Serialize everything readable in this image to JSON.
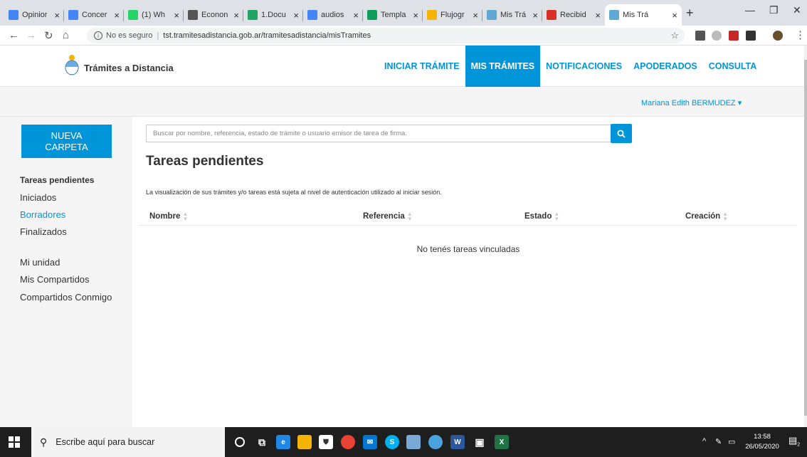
{
  "browser": {
    "tabs": [
      {
        "title": "Opinior",
        "icon": "docs-icon",
        "color": "#4285f4"
      },
      {
        "title": "Concer",
        "icon": "docs-icon",
        "color": "#4285f4"
      },
      {
        "title": "(1) Wh",
        "icon": "whatsapp-icon",
        "color": "#25d366"
      },
      {
        "title": "Econon",
        "icon": "site-icon",
        "color": "#555555"
      },
      {
        "title": "1.Docu",
        "icon": "drive-icon",
        "color": "#1fa463"
      },
      {
        "title": "audios",
        "icon": "docs-icon",
        "color": "#4285f4"
      },
      {
        "title": "Templa",
        "icon": "sheets-icon",
        "color": "#0f9d58"
      },
      {
        "title": "Flujogr",
        "icon": "slides-icon",
        "color": "#f4b400"
      },
      {
        "title": "Mis Trá",
        "icon": "shield-icon",
        "color": "#5fa8d3"
      },
      {
        "title": "Recibid",
        "icon": "gmail-icon",
        "color": "#d93025"
      },
      {
        "title": "Mis Trá",
        "icon": "shield-icon",
        "color": "#5fa8d3",
        "active": true
      }
    ],
    "address": {
      "security_label": "No es seguro",
      "url": "tst.tramitesadistancia.gob.ar/tramitesadistancia/misTramites"
    }
  },
  "site": {
    "logo_text": "Trámites a Distancia",
    "nav": [
      {
        "label": "INICIAR TRÁMITE",
        "active": false
      },
      {
        "label": "MIS TRÁMITES",
        "active": true
      },
      {
        "label": "NOTIFICACIONES",
        "active": false
      },
      {
        "label": "APODERADOS",
        "active": false
      },
      {
        "label": "CONSULTA",
        "active": false
      }
    ],
    "user": {
      "name": "Mariana Edith BERMUDEZ ▾"
    },
    "colors": {
      "accent": "#0095d9"
    }
  },
  "sidebar": {
    "new_folder_label": "NUEVA CARPETA",
    "items": [
      {
        "label": "Tareas pendientes",
        "state": "bold"
      },
      {
        "label": "Iniciados",
        "state": "normal"
      },
      {
        "label": "Borradores",
        "state": "link"
      },
      {
        "label": "Finalizados",
        "state": "normal"
      },
      {
        "label": "Mi unidad",
        "state": "normal"
      },
      {
        "label": "Mis Compartidos",
        "state": "normal"
      },
      {
        "label": "Compartidos Conmigo",
        "state": "normal"
      }
    ]
  },
  "main": {
    "search_placeholder": "Buscar por nombre, referencia, estado de trámite o usuario emisor de tarea de firma.",
    "title": "Tareas pendientes",
    "notice": "La visualización de sus trámites y/o tareas está sujeta al nivel de autenticación utilizado al iniciar sesión.",
    "columns": [
      "Nombre",
      "Referencia",
      "Estado",
      "Creación"
    ],
    "empty_message": "No tenés tareas vinculadas"
  },
  "taskbar": {
    "search_placeholder": "Escribe aquí para buscar",
    "time": "13:58",
    "date": "26/05/2020",
    "notification_count": "2"
  }
}
